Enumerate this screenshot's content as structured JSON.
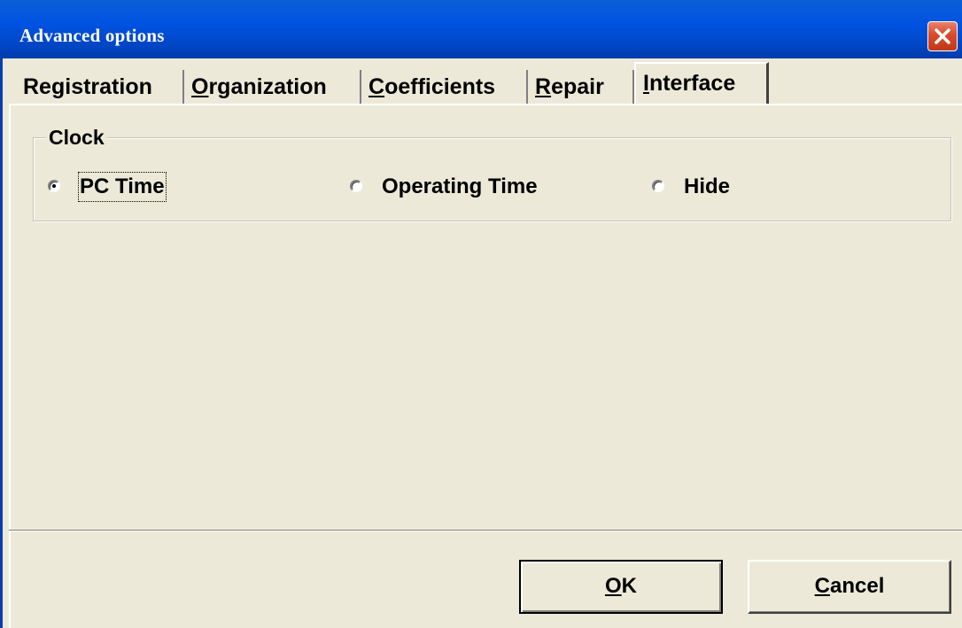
{
  "window": {
    "title": "Advanced options"
  },
  "tabs": [
    {
      "pre": "Re",
      "u": "g",
      "post": "istration",
      "active": false
    },
    {
      "pre": "",
      "u": "O",
      "post": "rganization",
      "active": false
    },
    {
      "pre": "",
      "u": "C",
      "post": "oefficients",
      "active": false
    },
    {
      "pre": "",
      "u": "R",
      "post": "epair",
      "active": false
    },
    {
      "pre": "",
      "u": "I",
      "post": "nterface",
      "active": true
    }
  ],
  "clock": {
    "legend": "Clock",
    "options": [
      {
        "label": "PC Time",
        "checked": true
      },
      {
        "label": "Operating Time",
        "checked": false
      },
      {
        "label": "Hide",
        "checked": false
      }
    ]
  },
  "buttons": {
    "ok": {
      "u": "O",
      "post": "K"
    },
    "cancel": {
      "u": "C",
      "post": "ancel"
    }
  },
  "colors": {
    "titlebar": "#0053E1",
    "face": "#ECE9D8",
    "close": "#D74B2B"
  }
}
